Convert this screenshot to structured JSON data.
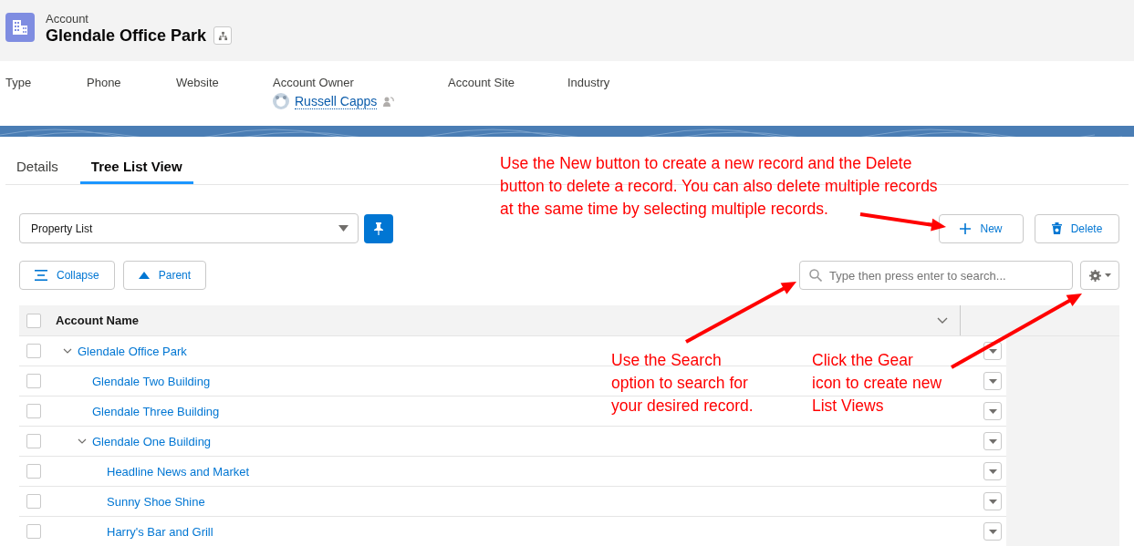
{
  "header": {
    "object_label": "Account",
    "title": "Glendale Office Park"
  },
  "fields": [
    {
      "label": "Type"
    },
    {
      "label": "Phone"
    },
    {
      "label": "Website"
    },
    {
      "label": "Account Owner",
      "value": "Russell Capps"
    },
    {
      "label": "Account Site"
    },
    {
      "label": "Industry"
    }
  ],
  "tabs": [
    {
      "label": "Details",
      "selected": false
    },
    {
      "label": "Tree List View",
      "selected": true
    }
  ],
  "list_view": {
    "value": "Property List"
  },
  "buttons": {
    "collapse": "Collapse",
    "parent": "Parent",
    "new": "New",
    "delete": "Delete"
  },
  "search": {
    "placeholder": "Type then press enter to search..."
  },
  "table": {
    "all_selected": false,
    "columns": [
      "Account Name"
    ],
    "rows": [
      {
        "name": "Glendale Office Park",
        "checked": false,
        "expanded": true,
        "children": [
          {
            "name": "Glendale Two Building",
            "checked": false
          },
          {
            "name": "Glendale Three Building",
            "checked": false
          },
          {
            "name": "Glendale One Building",
            "checked": false,
            "expanded": true,
            "children": [
              {
                "name": "Headline News and Market",
                "checked": false
              },
              {
                "name": "Sunny Shoe Shine",
                "checked": false
              },
              {
                "name": "Harry's Bar and Grill",
                "checked": false
              }
            ]
          }
        ]
      }
    ]
  },
  "annotations": [
    {
      "text": "Use the New button to create a new record and the Delete\nbutton to delete a record. You can also delete multiple records\nat the same time by selecting multiple records."
    },
    {
      "text": "Use the Search\noption to search for\nyour desired record."
    },
    {
      "text": "Click the Gear\nicon to create new\nList Views"
    }
  ]
}
